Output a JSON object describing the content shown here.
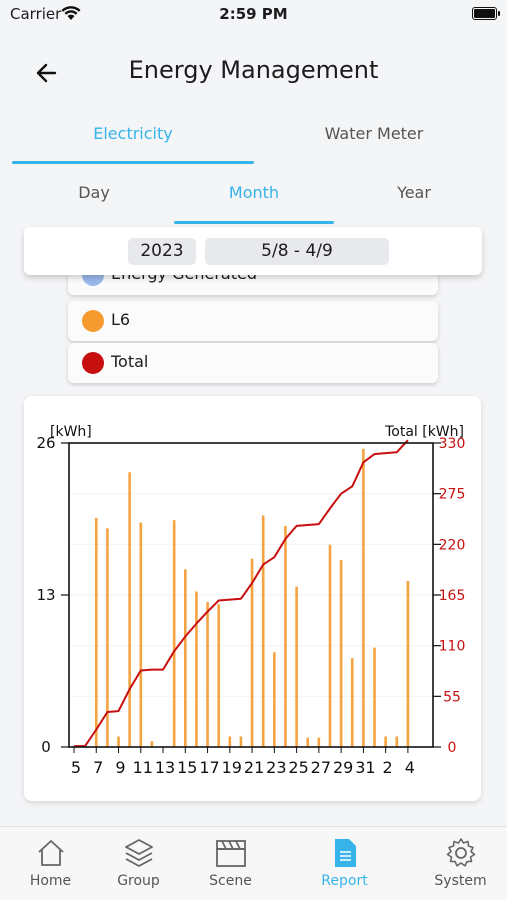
{
  "status_bar": {
    "carrier": "Carrier",
    "time": "2:59 PM"
  },
  "header": {
    "title": "Energy Management",
    "back_icon": "arrow-left-icon"
  },
  "meter_tabs": [
    {
      "label": "Electricity",
      "active": true
    },
    {
      "label": "Water Meter",
      "active": false
    }
  ],
  "period_tabs": [
    {
      "label": "Day",
      "active": false
    },
    {
      "label": "Month",
      "active": true
    },
    {
      "label": "Year",
      "active": false
    }
  ],
  "date_selector": {
    "year": "2023",
    "range": "5/8  - 4/9"
  },
  "legend": [
    {
      "label": "Energy Generated",
      "color": "#9ab8ea"
    },
    {
      "label": "L6",
      "color": "#f59a2f"
    },
    {
      "label": "Total",
      "color": "#c80f0f"
    }
  ],
  "chart_data": {
    "type": "bar",
    "left_axis_label": "[kWh]",
    "right_axis_label": "Total [kWh]",
    "left_ticks": [
      "26",
      "13",
      "0"
    ],
    "right_ticks": [
      "330",
      "275",
      "220",
      "165",
      "110",
      "55",
      "0"
    ],
    "x_ticks": [
      "5",
      "7",
      "9",
      "11",
      "13",
      "15",
      "17",
      "19",
      "21",
      "23",
      "25",
      "27",
      "29",
      "31",
      "2",
      "4"
    ],
    "ylim_left": [
      0,
      26
    ],
    "ylim_right": [
      0,
      330
    ],
    "bar_color": "#f5a341",
    "line_color": "#c80f0f",
    "series": [
      {
        "name": "L6",
        "type": "bar",
        "axis": "left",
        "values": [
          0,
          0,
          19.6,
          18.7,
          0.9,
          23.5,
          19.2,
          0.5,
          0,
          19.4,
          15.2,
          13.3,
          12.4,
          12.2,
          0.9,
          0.9,
          16.1,
          19.8,
          8.1,
          18.9,
          13.7,
          0.8,
          0.8,
          17.3,
          16.0,
          7.6,
          25.5,
          8.5,
          0.9,
          0.9,
          14.2
        ]
      },
      {
        "name": "Total",
        "type": "line",
        "axis": "right",
        "values": [
          1,
          1,
          19,
          38,
          39,
          63,
          83,
          84,
          84,
          104,
          120,
          134,
          147,
          159,
          160,
          161,
          178,
          198,
          206,
          226,
          240,
          241,
          242,
          259,
          275,
          283,
          309,
          318,
          319,
          320,
          333
        ]
      }
    ]
  },
  "tabbar": [
    {
      "label": "Home",
      "icon": "home-icon",
      "active": false
    },
    {
      "label": "Group",
      "icon": "layers-icon",
      "active": false
    },
    {
      "label": "Scene",
      "icon": "clapperboard-icon",
      "active": false
    },
    {
      "label": "Report",
      "icon": "report-icon",
      "active": true
    },
    {
      "label": "System",
      "icon": "gear-icon",
      "active": false
    }
  ],
  "colors": {
    "accent": "#36b4ea",
    "bar": "#f5a341",
    "line": "#c80f0f"
  }
}
